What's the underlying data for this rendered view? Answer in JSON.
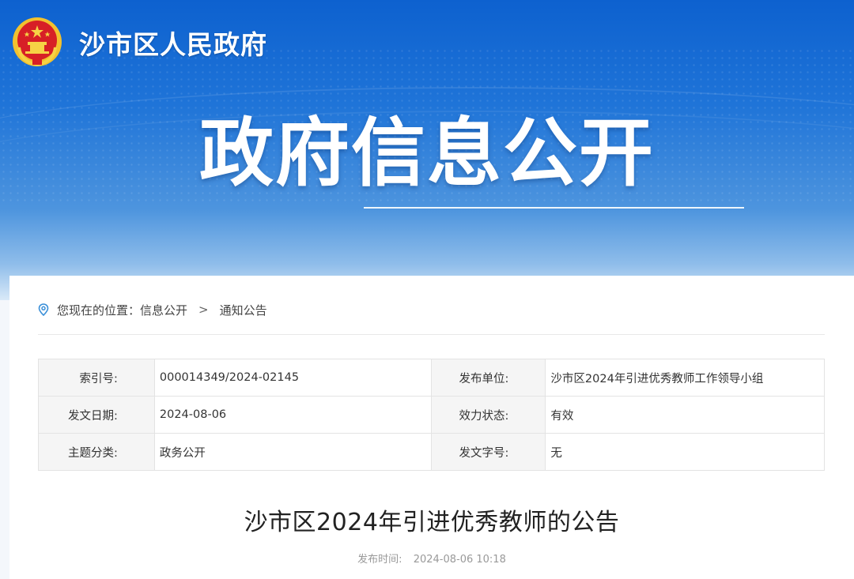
{
  "header": {
    "site_name": "沙市区人民政府",
    "hero_title": "政府信息公开",
    "emblem_icon": "national-emblem-icon"
  },
  "breadcrumb": {
    "prefix": "您现在的位置：",
    "items": [
      "信息公开",
      "通知公告"
    ],
    "separator": ">"
  },
  "meta": {
    "rows": [
      {
        "label1": "索引号:",
        "value1": "000014349/2024-02145",
        "label2": "发布单位:",
        "value2": "沙市区2024年引进优秀教师工作领导小组"
      },
      {
        "label1": "发文日期:",
        "value1": "2024-08-06",
        "label2": "效力状态:",
        "value2": "有效"
      },
      {
        "label1": "主题分类:",
        "value1": "政务公开",
        "label2": "发文字号:",
        "value2": "无"
      }
    ]
  },
  "article": {
    "title": "沙市区2024年引进优秀教师的公告",
    "publish_label": "发布时间:",
    "publish_time": "2024-08-06 10:18"
  },
  "colors": {
    "banner_top": "#0d61cf",
    "banner_bottom": "#d9e9f8",
    "accent_pin": "#3a8fd8"
  }
}
